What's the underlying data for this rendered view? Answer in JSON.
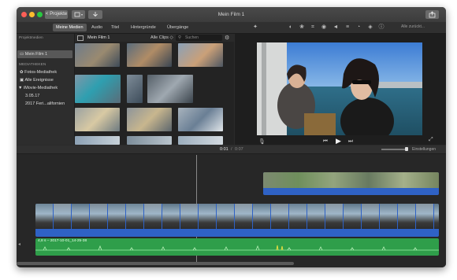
{
  "titlebar": {
    "back_label": "< Projekte",
    "title": "Mein Film 1"
  },
  "tabs": {
    "items": [
      "Meine Medien",
      "Audio",
      "Titel",
      "Hintergründe",
      "Übergänge"
    ],
    "active": "Meine Medien"
  },
  "viewer_toolbar": {
    "icons": [
      "magic-wand-icon",
      "color-balance-icon",
      "color-correction-icon",
      "crop-icon",
      "stabilization-icon",
      "volume-icon",
      "equalizer-icon",
      "speed-icon",
      "noise-reduction-icon",
      "info-icon"
    ],
    "reset_label": "Alle zurückt..."
  },
  "sidebar": {
    "project_media_header": "Projektmedien",
    "project_item": "Mein Film 1",
    "library_header": "MEDIATHEKEN",
    "items": [
      {
        "label": "Fotos-Mediathek",
        "icon": "photos-icon"
      },
      {
        "label": "Alle Ereignisse",
        "icon": "events-icon"
      },
      {
        "label": "▼ iMovie-Mediathek",
        "icon": ""
      },
      {
        "label": "3.05.17",
        "icon": ""
      },
      {
        "label": "2017 Feri...alifornien",
        "icon": ""
      }
    ]
  },
  "browser": {
    "title": "Mein Film 1",
    "filter": "Alle Clips ◇",
    "search_placeholder": "Suchen"
  },
  "viewer": {
    "time_current": "0:01",
    "time_separator": "/",
    "time_total": "0:07"
  },
  "timeline": {
    "settings_label": "Einstellungen",
    "audio_label": "4,8 s – 2017-10-01_14-25-38"
  },
  "colors": {
    "video_track": "#2f62c5",
    "audio_track": "#2f9e4a",
    "selected_sidebar": "#585858"
  }
}
